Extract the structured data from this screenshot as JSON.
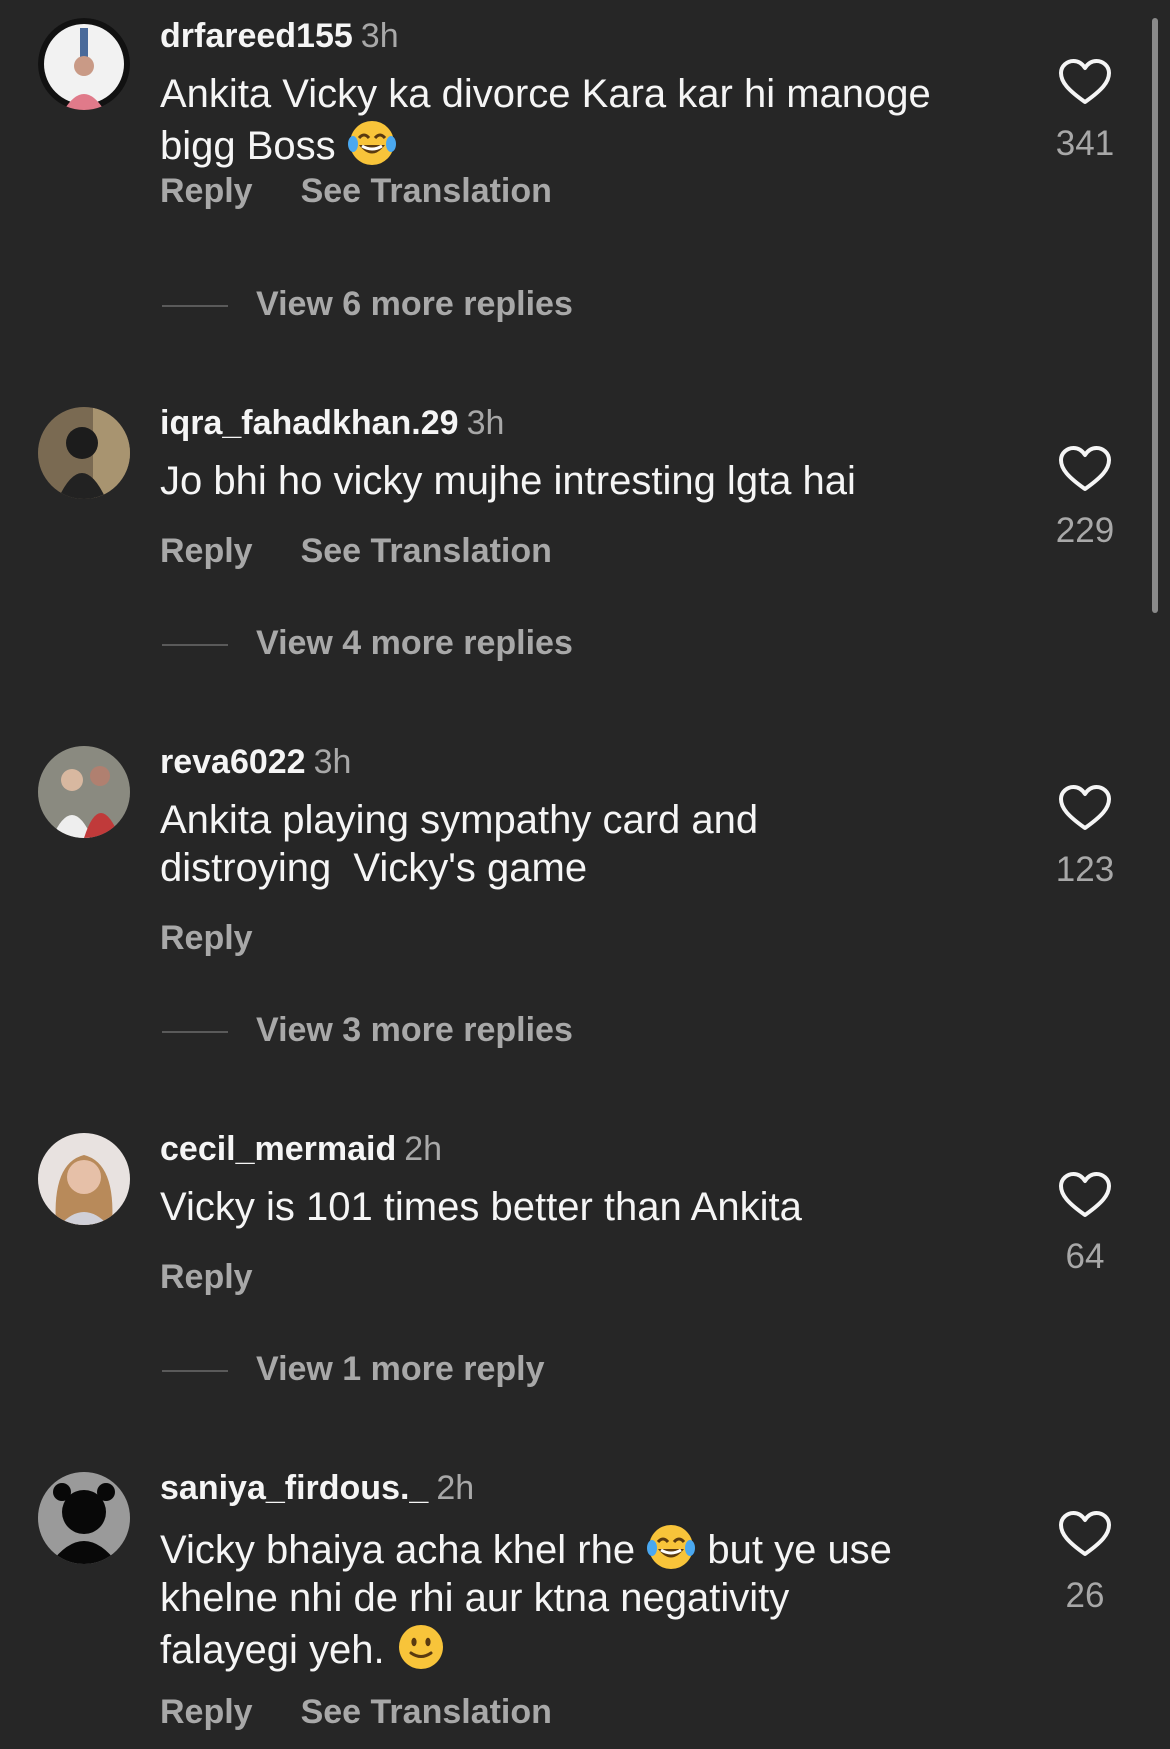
{
  "comments": [
    {
      "username": "drfareed155",
      "time": "3h",
      "text": "Ankita Vicky ka divorce Kara kar hi manoge",
      "text2": "bigg Boss",
      "emoji": "face-with-tears-of-joy",
      "likes": "341",
      "reply": "Reply",
      "translate": "See Translation",
      "more": "View 6 more replies"
    },
    {
      "username": "iqra_fahadkhan.29",
      "time": "3h",
      "text": "Jo bhi ho vicky mujhe intresting lgta hai",
      "likes": "229",
      "reply": "Reply",
      "translate": "See Translation",
      "more": "View 4 more replies"
    },
    {
      "username": "reva6022",
      "time": "3h",
      "text": "Ankita playing sympathy card and",
      "text2": "distroying  Vicky's game",
      "likes": "123",
      "reply": "Reply",
      "more": "View 3 more replies"
    },
    {
      "username": "cecil_mermaid",
      "time": "2h",
      "text": "Vicky is 101 times better than Ankita",
      "likes": "64",
      "reply": "Reply",
      "more": "View 1 more reply"
    },
    {
      "username": "saniya_firdous._",
      "time": "2h",
      "text_a": "Vicky bhaiya acha khel rhe",
      "text_b": "but ye use",
      "text2": "khelne nhi de rhi aur ktna negativity",
      "text3": "falayegi yeh.",
      "emoji": "face-with-tears-of-joy",
      "emoji2": "slightly-smiling-face",
      "likes": "26",
      "reply": "Reply",
      "translate": "See Translation"
    }
  ],
  "icons": {
    "like": "heart-outline-icon"
  },
  "colors": {
    "background": "#262626",
    "primary_text": "#f5f5f5",
    "secondary_text": "#a8a8a8"
  }
}
